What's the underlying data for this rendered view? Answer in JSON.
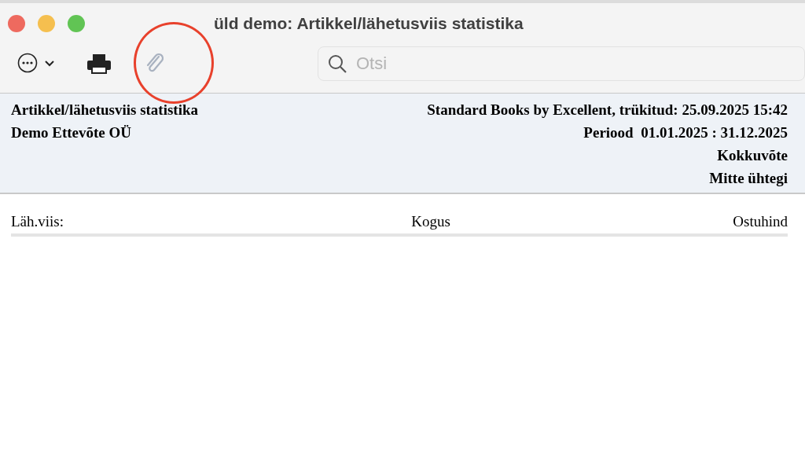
{
  "window": {
    "title": "üld demo: Artikkel/lähetusviis statistika"
  },
  "toolbar": {
    "buttons": [
      {
        "kind": "more",
        "disabled": false
      },
      {
        "kind": "print",
        "disabled": false
      },
      {
        "kind": "attach",
        "disabled": true
      }
    ],
    "search": {
      "placeholder": "Otsi"
    }
  },
  "annotations": [
    {
      "kind": "circle"
    }
  ],
  "report_header": {
    "left": [
      "Artikkel/lähetusviis statistika",
      "Demo Ettevõte OÜ"
    ],
    "right": [
      "Standard Books by Excellent, trükitud: 25.09.2025 15:42",
      "Periood  01.01.2025 : 31.12.2025",
      "Kokkuvõte",
      "Mitte ühtegi"
    ]
  },
  "table": {
    "columns": [
      "Läh.viis:",
      "Kogus",
      "Ostuhind"
    ]
  }
}
